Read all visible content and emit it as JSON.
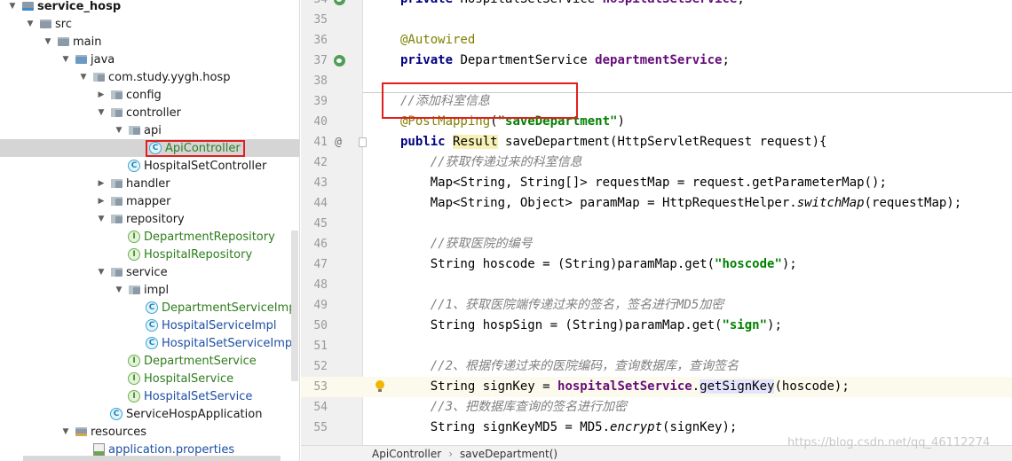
{
  "tree": {
    "items": [
      {
        "label": "service_hosp",
        "icon": "module-folder-icon",
        "arrow": "down",
        "depth": 0,
        "style": "bold"
      },
      {
        "label": "src",
        "icon": "folder-icon",
        "arrow": "down",
        "depth": 1
      },
      {
        "label": "main",
        "icon": "folder-icon",
        "arrow": "down",
        "depth": 2
      },
      {
        "label": "java",
        "icon": "source-folder-icon",
        "arrow": "down",
        "depth": 3
      },
      {
        "label": "com.study.yygh.hosp",
        "icon": "package-icon",
        "arrow": "down",
        "depth": 4
      },
      {
        "label": "config",
        "icon": "package-icon",
        "arrow": "right",
        "depth": 5
      },
      {
        "label": "controller",
        "icon": "package-icon",
        "arrow": "down",
        "depth": 5
      },
      {
        "label": "api",
        "icon": "package-icon",
        "arrow": "down",
        "depth": 6
      },
      {
        "label": "ApiController",
        "icon": "class-icon",
        "arrow": "",
        "depth": 7,
        "selected": true
      },
      {
        "label": "HospitalSetController",
        "icon": "class-icon",
        "arrow": "",
        "depth": 6
      },
      {
        "label": "handler",
        "icon": "package-icon",
        "arrow": "right",
        "depth": 5
      },
      {
        "label": "mapper",
        "icon": "package-icon",
        "arrow": "right",
        "depth": 5
      },
      {
        "label": "repository",
        "icon": "package-icon",
        "arrow": "down",
        "depth": 5
      },
      {
        "label": "DepartmentRepository",
        "icon": "interface-icon",
        "arrow": "",
        "depth": 6,
        "style": "green"
      },
      {
        "label": "HospitalRepository",
        "icon": "interface-icon",
        "arrow": "",
        "depth": 6,
        "style": "green"
      },
      {
        "label": "service",
        "icon": "package-icon",
        "arrow": "down",
        "depth": 5
      },
      {
        "label": "impl",
        "icon": "package-icon",
        "arrow": "down",
        "depth": 6
      },
      {
        "label": "DepartmentServiceImpl",
        "icon": "class-icon",
        "arrow": "",
        "depth": 7,
        "style": "green"
      },
      {
        "label": "HospitalServiceImpl",
        "icon": "class-icon",
        "arrow": "",
        "depth": 7,
        "style": "blue"
      },
      {
        "label": "HospitalSetServiceImpl",
        "icon": "class-icon",
        "arrow": "",
        "depth": 7,
        "style": "blue"
      },
      {
        "label": "DepartmentService",
        "icon": "interface-icon",
        "arrow": "",
        "depth": 6,
        "style": "green"
      },
      {
        "label": "HospitalService",
        "icon": "interface-icon",
        "arrow": "",
        "depth": 6,
        "style": "green"
      },
      {
        "label": "HospitalSetService",
        "icon": "interface-icon",
        "arrow": "",
        "depth": 6,
        "style": "blue"
      },
      {
        "label": "ServiceHospApplication",
        "icon": "spring-app-icon",
        "arrow": "",
        "depth": 5
      },
      {
        "label": "resources",
        "icon": "resources-folder-icon",
        "arrow": "down",
        "depth": 3
      },
      {
        "label": "application.properties",
        "icon": "properties-file-icon",
        "arrow": "",
        "depth": 4,
        "style": "blue"
      }
    ]
  },
  "editor": {
    "lines": [
      {
        "num": "34",
        "gutter": "implemented-icon",
        "tokens": [
          [
            "k",
            "private "
          ],
          [
            "",
            "HospitalSetService "
          ],
          [
            "fld",
            "hospitalSetService"
          ],
          [
            "",
            ";"
          ]
        ]
      },
      {
        "num": "35",
        "tokens": []
      },
      {
        "num": "36",
        "tokens": [
          [
            "ann",
            "@Autowired"
          ]
        ]
      },
      {
        "num": "37",
        "gutter": "implemented-icon",
        "tokens": [
          [
            "k",
            "private "
          ],
          [
            "",
            "DepartmentService "
          ],
          [
            "fld",
            "departmentService"
          ],
          [
            "",
            ";"
          ]
        ]
      },
      {
        "num": "38",
        "tokens": []
      },
      {
        "num": "39",
        "tokens": [
          [
            "cmt",
            "//添加科室信息"
          ]
        ]
      },
      {
        "num": "40",
        "tokens": [
          [
            "ann",
            "@PostMapping"
          ],
          [
            "",
            "("
          ],
          [
            "str",
            "\"saveDepartment\""
          ],
          [
            "",
            ")"
          ]
        ]
      },
      {
        "num": "41",
        "gutter": "override-at-icon",
        "fold": true,
        "tokens": [
          [
            "k",
            "public "
          ],
          [
            "hl",
            "Result"
          ],
          [
            "",
            " saveDepartment(HttpServletRequest request){"
          ]
        ]
      },
      {
        "num": "42",
        "tokens": [
          [
            "",
            "    "
          ],
          [
            "cmt",
            "//获取传递过来的科室信息"
          ]
        ]
      },
      {
        "num": "43",
        "tokens": [
          [
            "",
            "    Map<String, String[]> requestMap = request.getParameterMap();"
          ]
        ]
      },
      {
        "num": "44",
        "tokens": [
          [
            "",
            "    Map<String, Object> paramMap = HttpRequestHelper."
          ],
          [
            "it",
            "switchMap"
          ],
          [
            "",
            "(requestMap);"
          ]
        ]
      },
      {
        "num": "45",
        "tokens": []
      },
      {
        "num": "46",
        "tokens": [
          [
            "",
            "    "
          ],
          [
            "cmt",
            "//获取医院的编号"
          ]
        ]
      },
      {
        "num": "47",
        "tokens": [
          [
            "",
            "    String hoscode = (String)paramMap.get("
          ],
          [
            "str",
            "\"hoscode\""
          ],
          [
            "",
            ");"
          ]
        ]
      },
      {
        "num": "48",
        "tokens": []
      },
      {
        "num": "49",
        "tokens": [
          [
            "",
            "    "
          ],
          [
            "cmt",
            "//1、获取医院端传递过来的签名，签名进行MD5加密"
          ]
        ]
      },
      {
        "num": "50",
        "tokens": [
          [
            "",
            "    String hospSign = (String)paramMap.get("
          ],
          [
            "str",
            "\"sign\""
          ],
          [
            "",
            ");"
          ]
        ]
      },
      {
        "num": "51",
        "tokens": []
      },
      {
        "num": "52",
        "tokens": [
          [
            "",
            "    "
          ],
          [
            "cmt",
            "//2、根据传递过来的医院编码，查询数据库，查询签名"
          ]
        ]
      },
      {
        "num": "53",
        "current": true,
        "bulb": true,
        "tokens": [
          [
            "",
            "    String signKey = "
          ],
          [
            "fld",
            "hospitalSetService"
          ],
          [
            "",
            "."
          ],
          [
            "uhl",
            "getSignKey"
          ],
          [
            "",
            "(hoscode);"
          ]
        ]
      },
      {
        "num": "54",
        "tokens": [
          [
            "",
            "    "
          ],
          [
            "cmt",
            "//3、把数据库查询的签名进行加密"
          ]
        ]
      },
      {
        "num": "55",
        "tokens": [
          [
            "",
            "    String signKeyMD5 = MD5."
          ],
          [
            "it",
            "encrypt"
          ],
          [
            "",
            "(signKey);"
          ]
        ]
      }
    ],
    "breadcrumb": [
      "ApiController",
      "saveDepartment()"
    ],
    "watermark": "https://blog.csdn.net/qq_46112274"
  },
  "colors": {
    "accent_red": "#e02020",
    "current_line": "#fcfaed",
    "selection": "#d5d5d5"
  }
}
